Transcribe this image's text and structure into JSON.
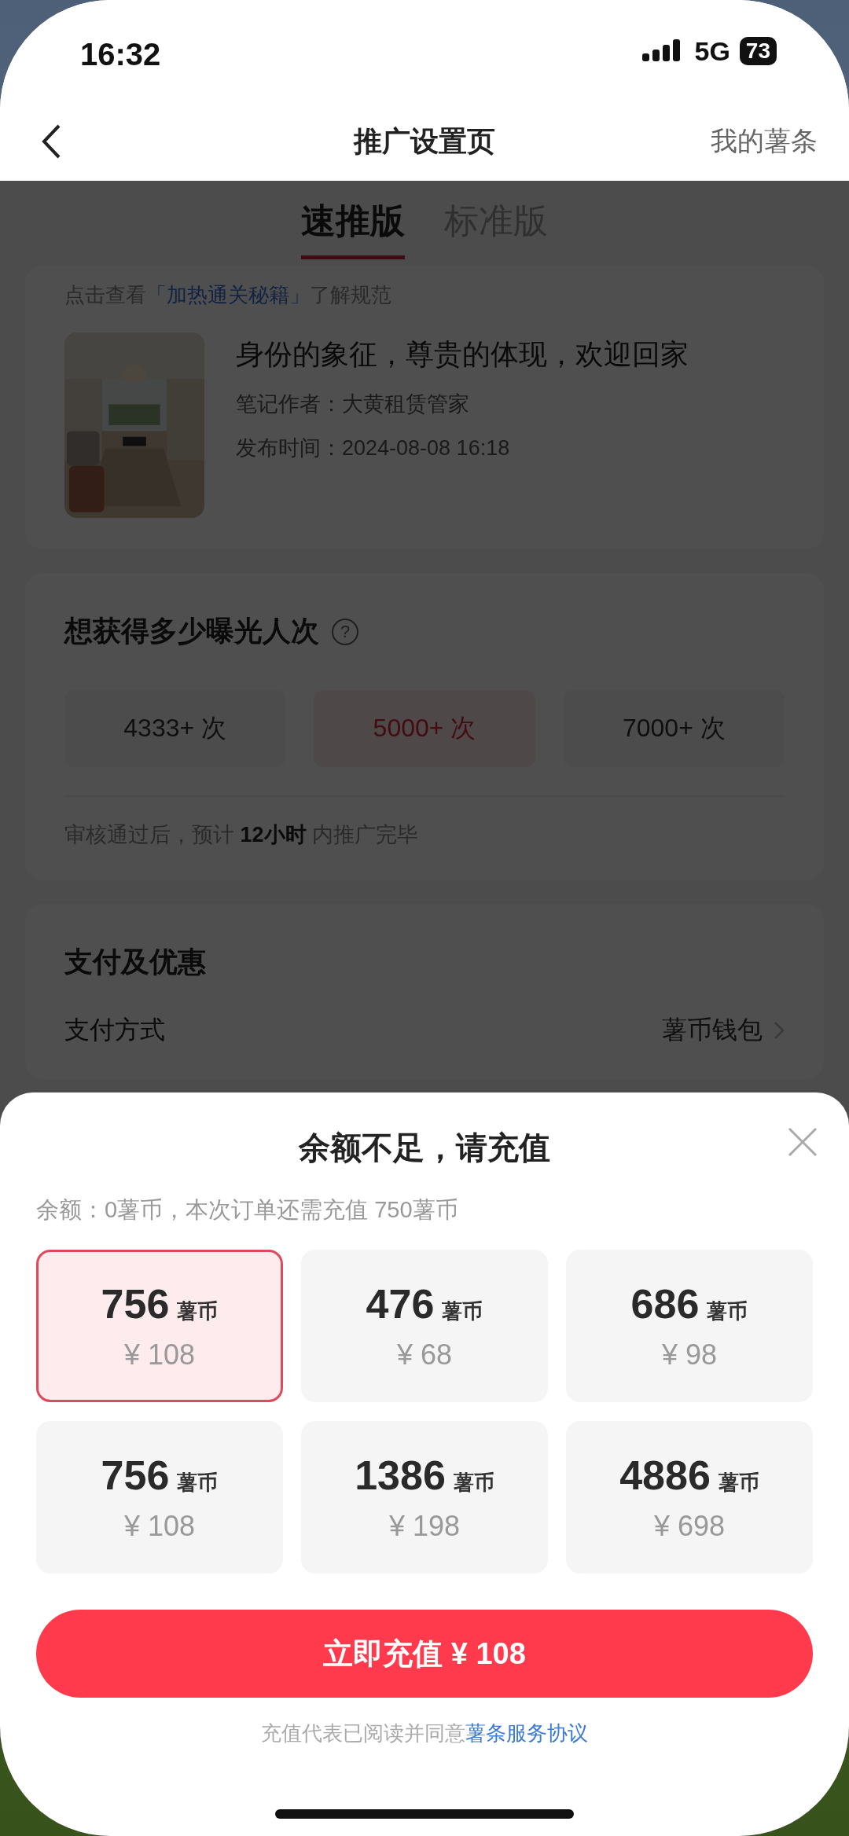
{
  "status_bar": {
    "time": "16:32",
    "network": "5G",
    "battery": "73"
  },
  "header": {
    "title": "推广设置页",
    "action": "我的薯条"
  },
  "tabs": [
    {
      "label": "速推版",
      "selected": true
    },
    {
      "label": "标准版",
      "selected": false
    }
  ],
  "note_card": {
    "hint_prefix": "点击查看",
    "hint_link": "「加热通关秘籍」",
    "hint_suffix": "了解规范",
    "title": "身份的象征，尊贵的体现，欢迎回家",
    "author": "笔记作者：大黄租赁管家",
    "published": "发布时间：2024-08-08 16:18"
  },
  "exposure": {
    "heading": "想获得多少曝光人次",
    "help": "?",
    "options": [
      {
        "label": "4333+ 次",
        "selected": false
      },
      {
        "label": "5000+ 次",
        "selected": true
      },
      {
        "label": "7000+ 次",
        "selected": false
      }
    ],
    "note": "审核通过后，预计 **12小时** 内推广完毕"
  },
  "payment": {
    "heading": "支付及优惠",
    "method_label": "支付方式",
    "method_value": "薯币钱包"
  },
  "recharge_sheet": {
    "title": "余额不足，请充值",
    "balance": "余额：0薯币，本次订单还需充值 750薯币",
    "packages": [
      {
        "amount": "756",
        "unit": "薯币",
        "price": "¥ 108",
        "selected": true
      },
      {
        "amount": "476",
        "unit": "薯币",
        "price": "¥ 68",
        "selected": false
      },
      {
        "amount": "686",
        "unit": "薯币",
        "price": "¥ 98",
        "selected": false
      },
      {
        "amount": "756",
        "unit": "薯币",
        "price": "¥ 108",
        "selected": false
      },
      {
        "amount": "1386",
        "unit": "薯币",
        "price": "¥ 198",
        "selected": false
      },
      {
        "amount": "4886",
        "unit": "薯币",
        "price": "¥ 698",
        "selected": false
      }
    ],
    "button": "立即充值 ¥ 108",
    "agreement_prefix": "充值代表已阅读并同意",
    "agreement_link": "薯条服务协议"
  }
}
